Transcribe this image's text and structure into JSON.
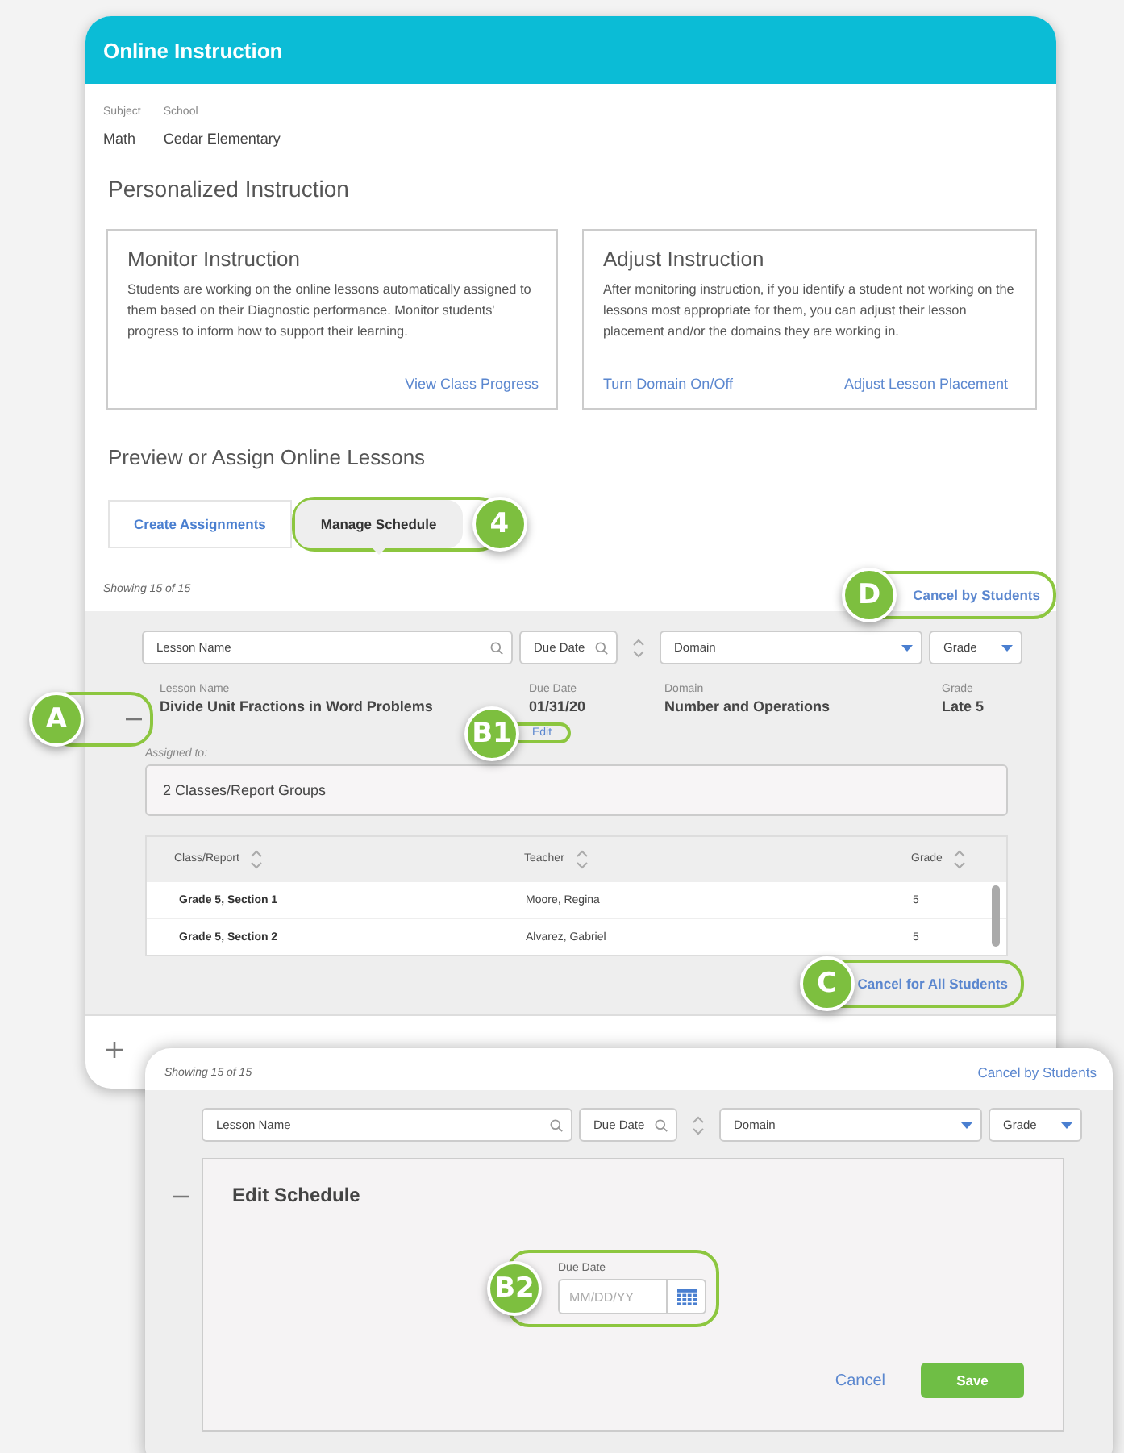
{
  "window": {
    "title": "Online Instruction"
  },
  "context": [
    {
      "label": "Subject",
      "value": "Math"
    },
    {
      "label": "School",
      "value": "Cedar Elementary"
    }
  ],
  "section_title": "Personalized Instruction",
  "cards": [
    {
      "title": "Monitor Instruction",
      "text": "Students are working on the online lessons automatically assigned to them based on their Diagnostic performance. Monitor students' progress to inform how to support their learning.",
      "links": [
        "View Class Progress"
      ]
    },
    {
      "title": "Adjust Instruction",
      "text": "After monitoring instruction, if you identify a student not working on the lessons most appropriate for them, you can adjust their lesson placement and/or the domains they are working in.",
      "links": [
        "Turn Domain On/Off",
        "Adjust Lesson Placement"
      ]
    }
  ],
  "lessons_title": "Preview or Assign Online Lessons",
  "tabs": [
    {
      "label": "Create Assignments",
      "selected": false
    },
    {
      "label": "Manage Schedule",
      "selected": true,
      "callout": "4"
    }
  ],
  "count": "Showing 15 of 15",
  "cancel_by_students": {
    "label": "Cancel by Students",
    "callout": "D"
  },
  "filters": [
    {
      "placeholder": "Lesson Name",
      "kind": "search",
      "sort_toggle": false
    },
    {
      "placeholder": "Due Date",
      "kind": "search",
      "sort_toggle": true
    },
    {
      "placeholder": "Domain",
      "kind": "select",
      "sort_toggle": false
    },
    {
      "placeholder": "Grade",
      "kind": "select",
      "sort_toggle": false
    }
  ],
  "lessons": [
    {
      "expanded": true,
      "callout": "A",
      "fields": [
        {
          "label": "Lesson Name",
          "value": "Divide Unit Fractions in Word Problems"
        },
        {
          "label": "Due Date",
          "value": "01/31/20",
          "action": {
            "label": "Edit",
            "callout": "B1"
          }
        },
        {
          "label": "Domain",
          "value": "Number and Operations"
        },
        {
          "label": "Grade",
          "value": "Late 5"
        }
      ],
      "assigned_label": "Assigned to:",
      "assigned_value": "2 Classes/Report Groups",
      "table": {
        "columns": [
          "Class/Report",
          "Teacher",
          "Grade"
        ],
        "rows": [
          [
            "Grade 5, Section 1",
            "Moore, Regina",
            "5"
          ],
          [
            "Grade 5, Section 2",
            "Alvarez, Gabriel",
            "5"
          ]
        ]
      },
      "cancel_all": {
        "label": "Cancel for All Students",
        "callout": "C"
      }
    },
    {
      "expanded": false
    }
  ],
  "overlay": {
    "count": "Showing 15 of 15",
    "cancel_by_students": "Cancel by Students",
    "filters": [
      {
        "placeholder": "Lesson Name",
        "kind": "search",
        "sort_toggle": false
      },
      {
        "placeholder": "Due Date",
        "kind": "search",
        "sort_toggle": true
      },
      {
        "placeholder": "Domain",
        "kind": "select",
        "sort_toggle": false
      },
      {
        "placeholder": "Grade",
        "kind": "select",
        "sort_toggle": false
      }
    ],
    "lesson": {
      "expanded": true
    },
    "edit": {
      "title": "Edit Schedule",
      "field": {
        "label": "Due Date",
        "placeholder": "MM/DD/YY",
        "callout": "B2"
      },
      "cancel": "Cancel",
      "save": "Save"
    }
  }
}
